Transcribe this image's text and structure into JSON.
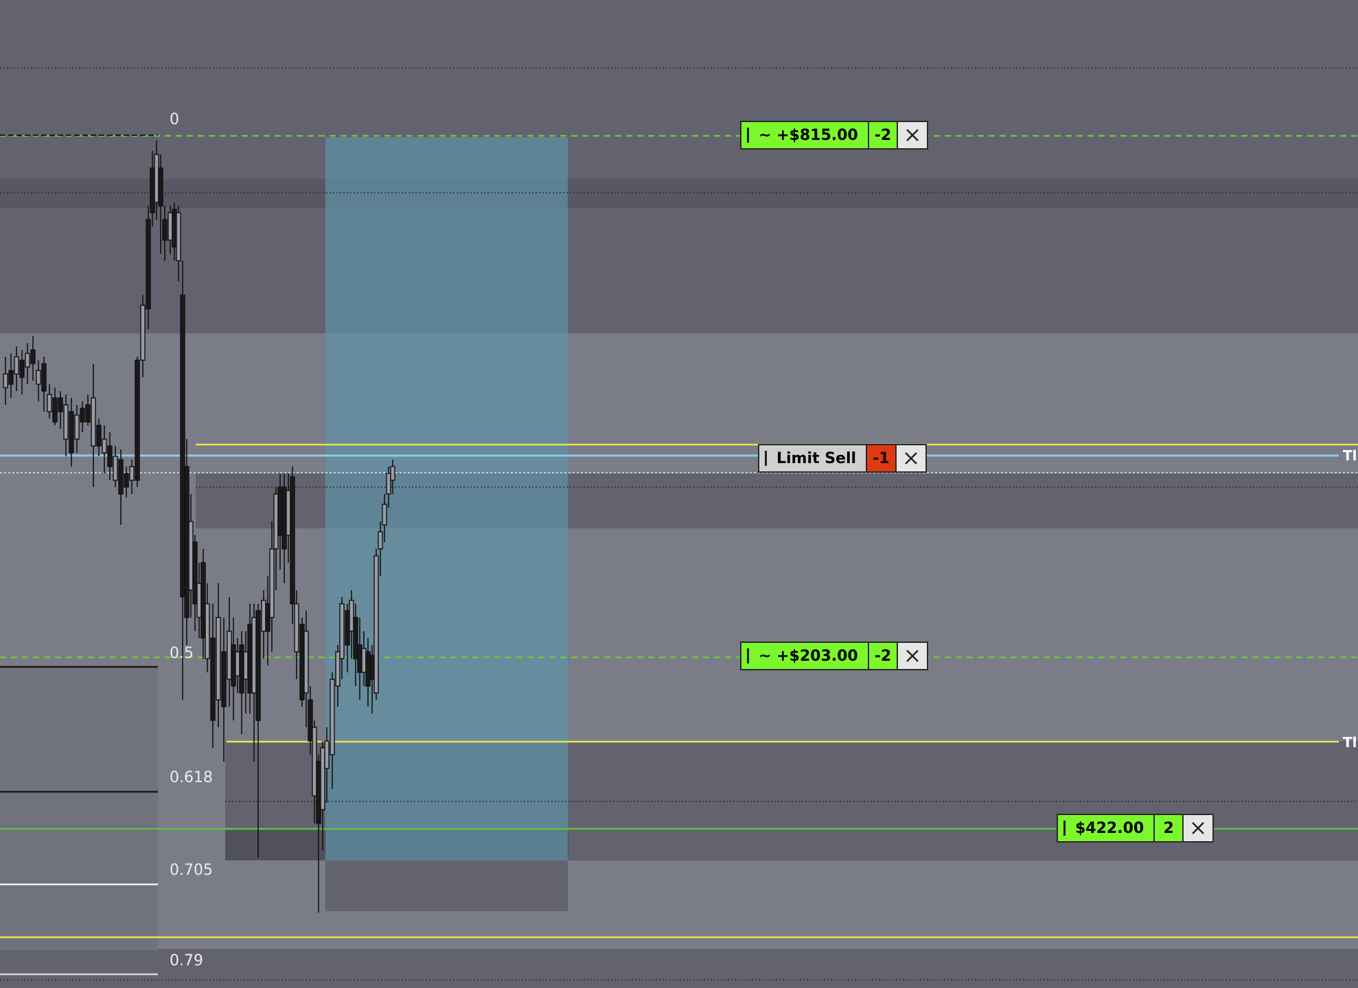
{
  "chart_data": {
    "type": "candlestick",
    "orders": [
      {
        "id": "order-top",
        "label": "~ +$815.00",
        "qty": "-2",
        "style": "profit"
      },
      {
        "id": "order-limit-sell",
        "label": "Limit Sell",
        "qty": "-1",
        "style": "pending"
      },
      {
        "id": "order-mid",
        "label": "~ +$203.00",
        "qty": "-2",
        "style": "profit"
      },
      {
        "id": "order-position",
        "label": "$422.00",
        "qty": "2",
        "style": "position"
      }
    ],
    "fib_levels": [
      "0",
      "0.5",
      "0.618",
      "0.705",
      "0.79"
    ],
    "edge_labels": [
      "Tl",
      "Tl"
    ]
  },
  "colors": {
    "background": "#7a7c88",
    "zone_dark": "#62636e",
    "highlight_box": "#5e93a6",
    "profit_green": "#7cf72b",
    "dash_green": "#74c23a",
    "yellow_line": "#e8e650",
    "green_line": "#5cc23a",
    "blue_line": "#8ecbe3",
    "sell_red": "#dd3a14"
  },
  "icons": {
    "close": "close-icon",
    "grip": "grip-handle-icon"
  }
}
